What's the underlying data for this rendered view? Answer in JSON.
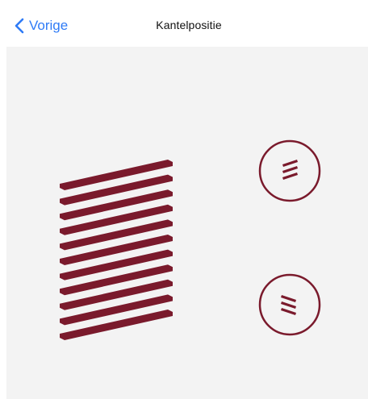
{
  "navbar": {
    "back_label": "Vorige",
    "title": "Kantelpositie"
  },
  "tilt_controls": {
    "up_icon": "tilt-up-icon",
    "down_icon": "tilt-down-icon"
  },
  "colors": {
    "accent": "#7a1a2c",
    "link": "#2f7bf6",
    "background": "#f3f3f3"
  }
}
